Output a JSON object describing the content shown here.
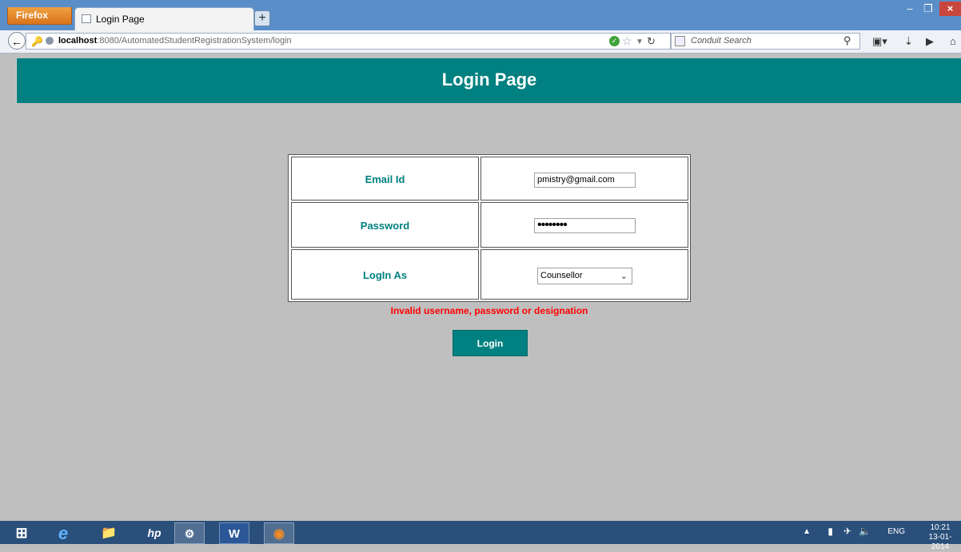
{
  "browser": {
    "menu_button": "Firefox",
    "tab_title": "Login Page",
    "new_tab": "+",
    "url_host": "localhost",
    "url_rest": ":8080/AutomatedStudentRegistrationSystem/login",
    "search_placeholder": "Conduit Search"
  },
  "page": {
    "title": "Login Page",
    "fields": {
      "email_label": "Email Id",
      "email_value": "pmistry@gmail.com",
      "password_label": "Password",
      "password_value": "••••••••",
      "role_label": "LogIn As",
      "role_value": "Counsellor"
    },
    "error": "Invalid username, password or designation",
    "login_button": "Login",
    "accent_color": "#008080",
    "error_color": "#ff0000"
  },
  "taskbar": {
    "language": "ENG",
    "time": "10:21",
    "date": "13-01-2014"
  }
}
